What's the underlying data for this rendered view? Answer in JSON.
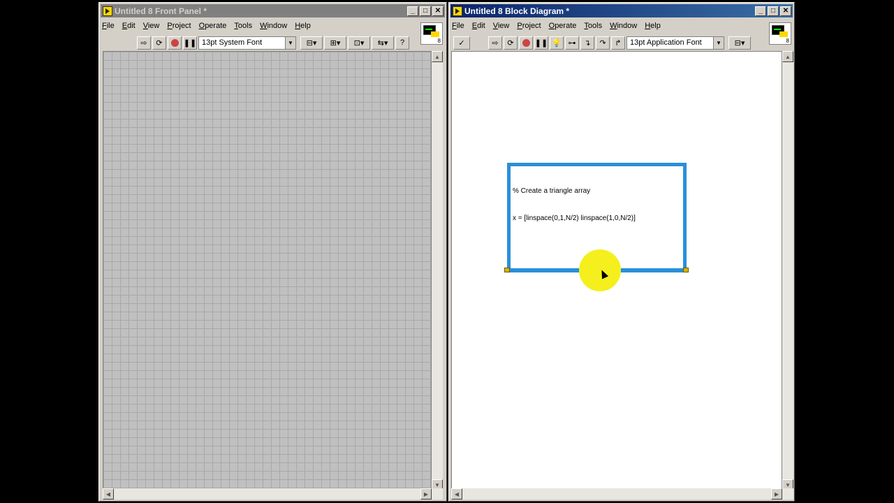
{
  "front_panel": {
    "title": "Untitled 8 Front Panel *",
    "menu": [
      "File",
      "Edit",
      "View",
      "Project",
      "Operate",
      "Tools",
      "Window",
      "Help"
    ],
    "font": "13pt System Font",
    "icon_number": "8"
  },
  "block_diagram": {
    "title": "Untitled 8 Block Diagram *",
    "menu": [
      "File",
      "Edit",
      "View",
      "Project",
      "Operate",
      "Tools",
      "Window",
      "Help"
    ],
    "font": "13pt Application Font",
    "icon_number": "8",
    "script_node": {
      "line1": "% Create a triangle array",
      "line2": "x = [linspace(0,1,N/2) linspace(1,0,N/2)]"
    }
  },
  "window_buttons": {
    "minimize": "_",
    "maximize": "□",
    "close": "✕"
  },
  "colors": {
    "node_border": "#2a8fd9",
    "cursor_highlight": "#f5ef1d",
    "grid_bg": "#c0c0c0"
  },
  "icons": [
    "run-arrow-icon",
    "run-continuously-icon",
    "abort-icon",
    "pause-icon",
    "highlight-execution-icon",
    "help-icon"
  ]
}
